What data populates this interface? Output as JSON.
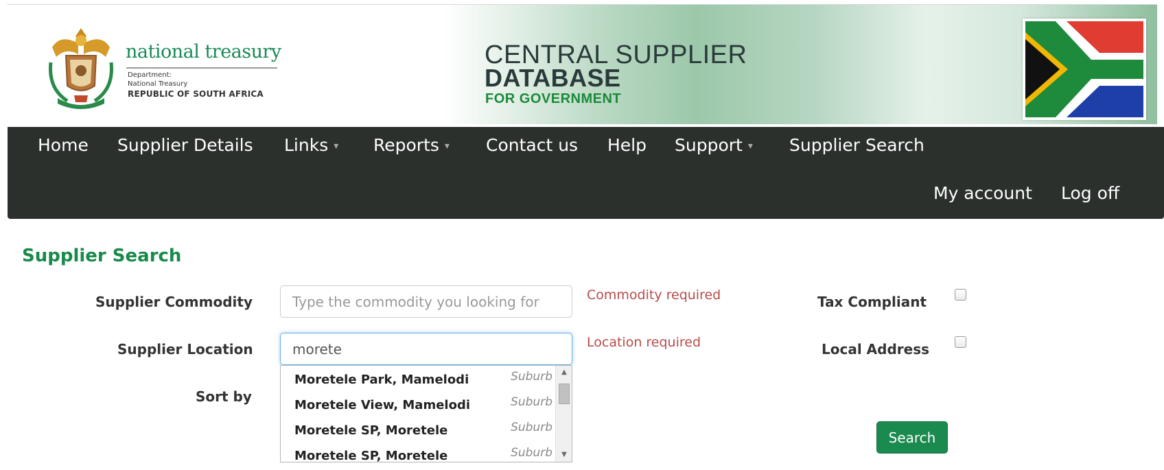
{
  "banner": {
    "logo_title": "national treasury",
    "logo_sub1": "Department:",
    "logo_sub2": "National Treasury",
    "logo_sub3": "REPUBLIC OF SOUTH AFRICA",
    "title_line1": "CENTRAL SUPPLIER",
    "title_line2": "DATABASE",
    "title_line3": "FOR GOVERNMENT"
  },
  "nav": {
    "home": "Home",
    "supplier_details": "Supplier Details",
    "links": "Links",
    "reports": "Reports",
    "contact": "Contact us",
    "help": "Help",
    "support": "Support",
    "supplier_search": "Supplier Search",
    "my_account": "My account",
    "log_off": "Log off",
    "caret": "▾"
  },
  "form": {
    "title": "Supplier Search",
    "commodity_label": "Supplier Commodity",
    "commodity_placeholder": "Type the commodity you looking for",
    "commodity_value": "",
    "commodity_error": "Commodity required",
    "location_label": "Supplier Location",
    "location_value": "morete",
    "location_error": "Location required",
    "sort_label": "Sort by",
    "tax_label": "Tax Compliant",
    "tax_checked": false,
    "local_label": "Local Address",
    "local_checked": false,
    "search_button": "Search"
  },
  "autocomplete": {
    "items": [
      {
        "name": "Moretele Park, Mamelodi",
        "type": "Suburb"
      },
      {
        "name": "Moretele View, Mamelodi",
        "type": "Suburb"
      },
      {
        "name": "Moretele SP, Moretele",
        "type": "Suburb"
      },
      {
        "name": "Moretele SP, Moretele",
        "type": "Suburb"
      }
    ],
    "scroll_up": "▲",
    "scroll_down": "▼"
  },
  "colors": {
    "brand_green": "#188a4a",
    "nav_background": "#2b302d",
    "error_red": "#b94a48",
    "button_green": "#1a8a4f"
  }
}
